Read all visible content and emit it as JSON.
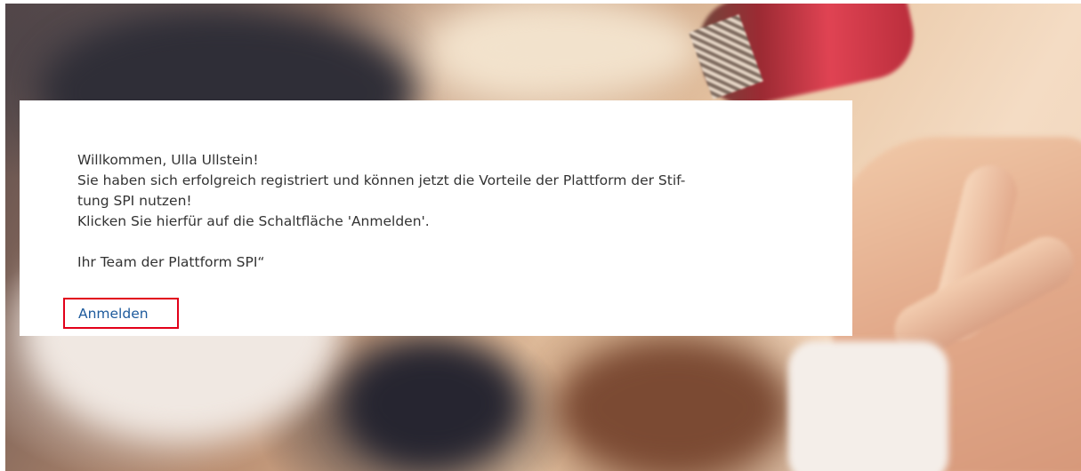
{
  "message": {
    "lines": [
      "Willkommen, Ulla Ullstein!",
      "Sie haben sich erfolgreich registriert und können jetzt die Vorteile der Plattform der Stif-",
      "tung SPI nutzen!",
      "Klicken Sie hierfür auf die Schaltfläche 'Anmelden'.",
      "",
      "Ihr Team der Plattform SPI“"
    ]
  },
  "login": {
    "label": "Anmelden",
    "highlight_color": "#e2001a",
    "link_color": "#1d5a9c"
  }
}
